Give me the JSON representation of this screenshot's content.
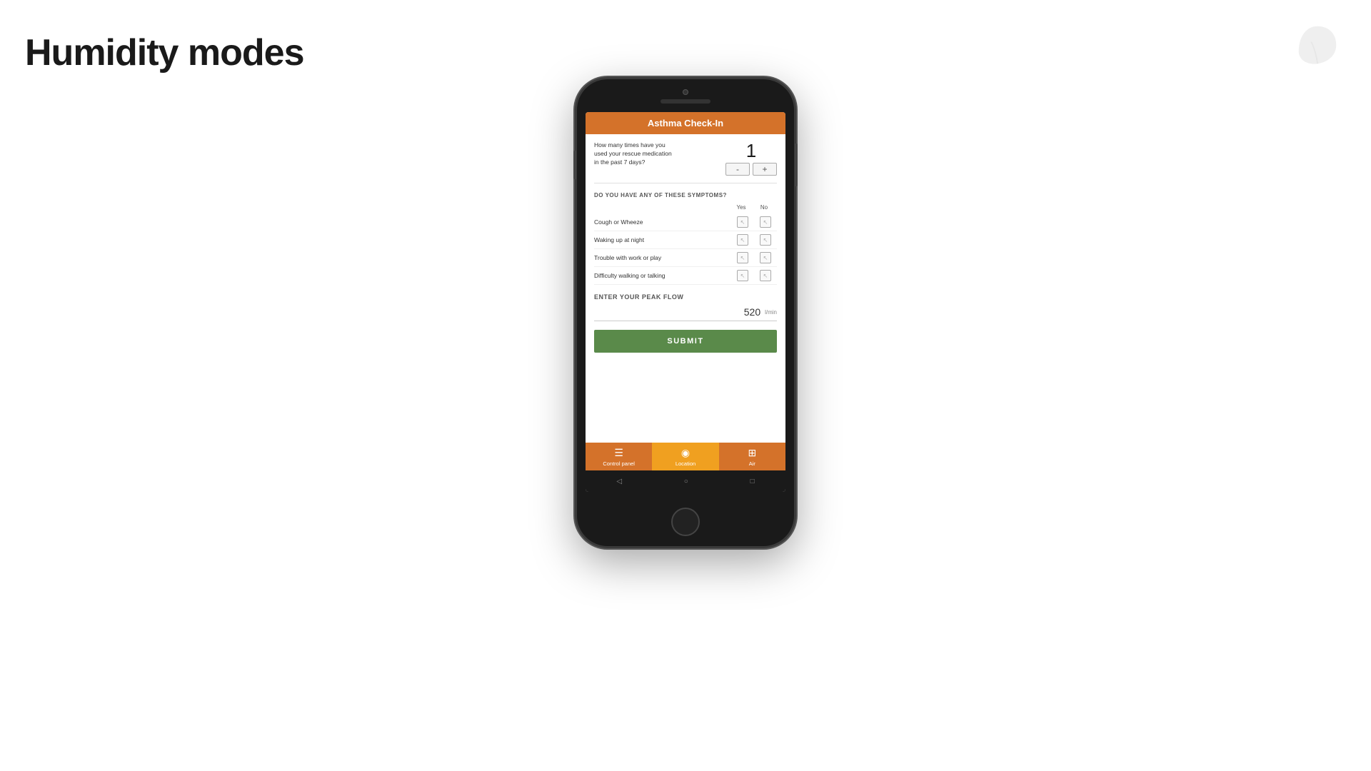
{
  "page": {
    "title": "Humidity modes",
    "logo_alt": "leaf-logo"
  },
  "phone": {
    "app": {
      "header": "Asthma Check-In",
      "rescue_question": "How many times have you used your rescue medication in the past 7 days?",
      "rescue_count": "1",
      "minus_label": "-",
      "plus_label": "+",
      "symptoms_title": "DO YOU HAVE ANY OF THESE SYMPTOMS?",
      "yes_label": "Yes",
      "no_label": "No",
      "symptoms": [
        {
          "label": "Cough or Wheeze"
        },
        {
          "label": "Waking up at night"
        },
        {
          "label": "Trouble with work or play"
        },
        {
          "label": "Difficulty walking or talking"
        }
      ],
      "peak_flow_title": "ENTER YOUR PEAK FLOW",
      "peak_flow_value": "520",
      "peak_flow_unit": "l/min",
      "submit_label": "SUBMIT",
      "nav_items": [
        {
          "label": "Control panel",
          "icon": "☰"
        },
        {
          "label": "Location",
          "icon": "📍"
        },
        {
          "label": "Air",
          "icon": "💨"
        }
      ]
    }
  }
}
